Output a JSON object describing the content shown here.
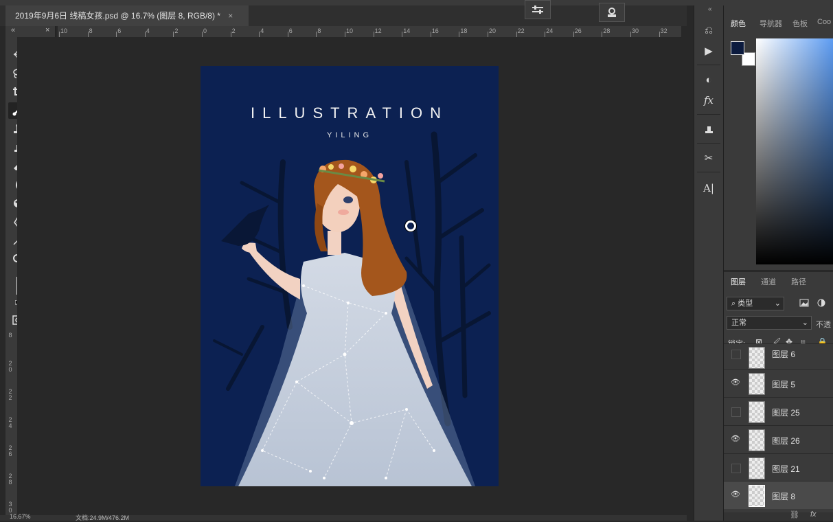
{
  "document": {
    "tab_title": "2019年9月6日 线稿女孩.psd @ 16.7% (图层 8, RGB/8) *",
    "close_glyph": "×",
    "zoom": "16.67%",
    "doc_info": "文档:24.9M/476.2M"
  },
  "rulers": {
    "horizontal": [
      "10",
      "8",
      "6",
      "4",
      "2",
      "0",
      "2",
      "4",
      "6",
      "8",
      "10",
      "12",
      "14",
      "16",
      "18",
      "20",
      "22",
      "24",
      "26",
      "28",
      "30",
      "32"
    ],
    "vertical": [
      "8",
      "2\n0",
      "2\n2",
      "2\n4",
      "2\n6",
      "2\n8",
      "3\n0"
    ]
  },
  "artwork": {
    "title": "ILLUSTRATION",
    "subtitle": "YILING",
    "colors": {
      "background": "#0c2152",
      "hair": "#a4561c",
      "dress": "#c5cfdc",
      "skin": "#f3d0bd",
      "branches": "#081633"
    }
  },
  "toolbar": {
    "collapse_glyph": "«",
    "close_glyph": "×",
    "foreground_color": "#0c1b3e",
    "background_color": "#ffffff"
  },
  "color_panel": {
    "tabs": [
      "颜色",
      "导航器",
      "色板",
      "Coo"
    ],
    "foreground_color": "#0c1b3e"
  },
  "layers_panel": {
    "tabs": [
      "图层",
      "通道",
      "路径"
    ],
    "filter_label": "类型",
    "blend_mode": "正常",
    "opacity_label": "不透",
    "lock_label": "锁定:",
    "layers": [
      {
        "name": "图层 6",
        "visible": false,
        "selected": false
      },
      {
        "name": "图层 5",
        "visible": true,
        "selected": false
      },
      {
        "name": "图层 25",
        "visible": false,
        "selected": false
      },
      {
        "name": "图层 26",
        "visible": true,
        "selected": false
      },
      {
        "name": "图层 21",
        "visible": false,
        "selected": false
      },
      {
        "name": "图层 8",
        "visible": true,
        "selected": true
      }
    ],
    "footer_fx": "fx"
  }
}
